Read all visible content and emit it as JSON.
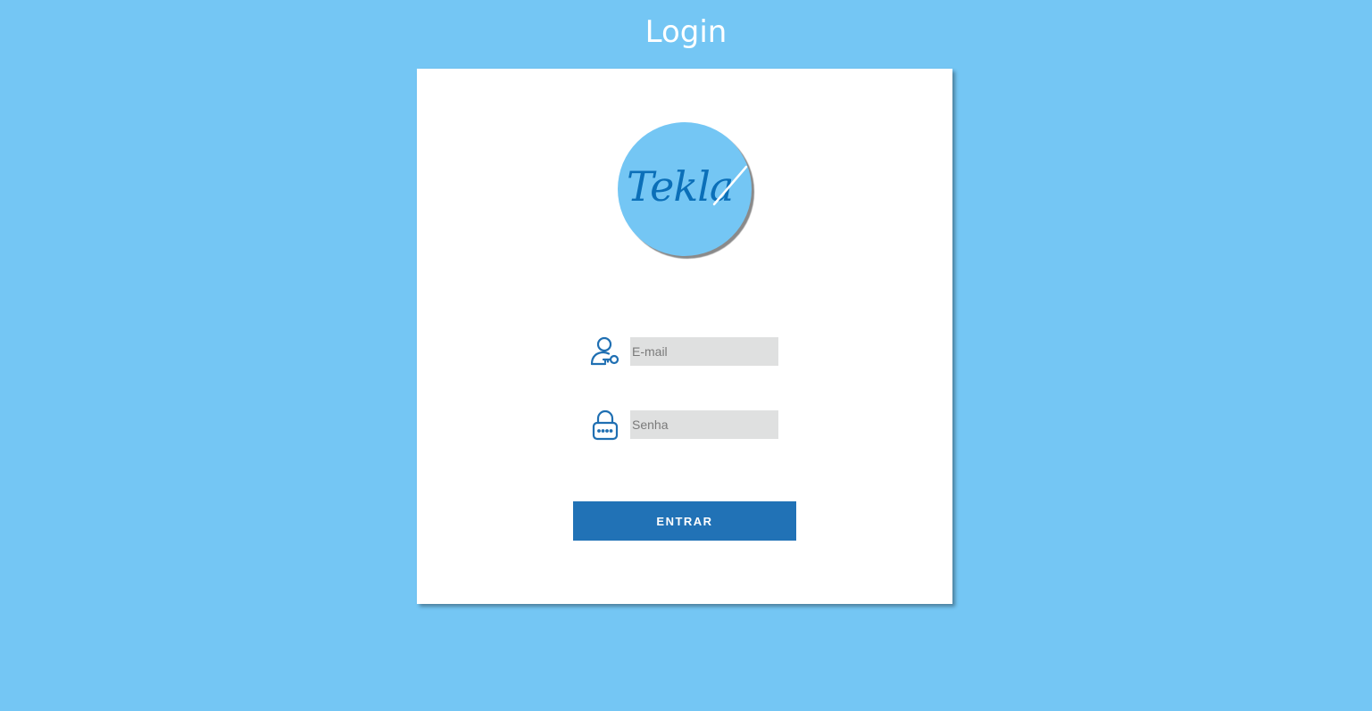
{
  "page": {
    "title": "Login"
  },
  "logo": {
    "text": "Tekla",
    "icon": "brand-logo",
    "background_color": "#74c6f4",
    "text_color": "#0b6fb8"
  },
  "form": {
    "email": {
      "icon": "user-key-icon",
      "placeholder": "E-mail",
      "value": ""
    },
    "password": {
      "icon": "lock-icon",
      "placeholder": "Senha",
      "value": ""
    },
    "submit_label": "ENTRAR"
  },
  "colors": {
    "background": "#74c6f4",
    "card": "#ffffff",
    "accent": "#2172b6",
    "icon": "#1f6fb2",
    "input_bg": "#dfe0e0"
  }
}
